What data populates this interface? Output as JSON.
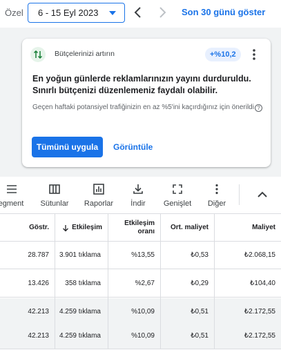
{
  "datebar": {
    "prefix": "Özel",
    "range": "6 - 15 Eyl 2023",
    "show_last_30": "Son 30 günü göster",
    "icons": {
      "prev": "chevron-left-icon",
      "next": "chevron-right-icon",
      "dropdown": "caret-down-icon"
    }
  },
  "card": {
    "icon": "sort-arrows-icon",
    "title": "Bütçelerinizi artırın",
    "badge": "+%10,2",
    "headline": "En yoğun günlerde reklamlarınızın yayını durduruldu. Sınırlı bütçenizi düzenlemeniz faydalı olabilir.",
    "body": "Geçen haftaki potansiyel trafiğinizin en az %5'ini kaçırdığınız için önerildi",
    "help_icon": "?",
    "apply_label": "Tümünü uygula",
    "view_label": "Görüntüle",
    "colors": {
      "accent": "#1a73e8",
      "badge_bg": "#e8f0fe",
      "icon_bg": "#e6f4ea"
    }
  },
  "toolbar": {
    "items": [
      {
        "label": "egment",
        "icon": "segment-icon"
      },
      {
        "label": "Sütunlar",
        "icon": "columns-icon"
      },
      {
        "label": "Raporlar",
        "icon": "reports-icon"
      },
      {
        "label": "İndir",
        "icon": "download-icon"
      },
      {
        "label": "Genişlet",
        "icon": "expand-icon"
      },
      {
        "label": "Diğer",
        "icon": "more-vert-icon"
      }
    ],
    "collapse_icon": "chevron-up-icon"
  },
  "table": {
    "headers": [
      "Göstr.",
      "Etkileşim",
      "Etkileşim oranı",
      "Ort. maliyet",
      "Maliyet"
    ],
    "sort_icon": "arrow-down-icon",
    "rows": [
      {
        "impr": "28.787",
        "interactions": "3.901 tıklama",
        "rate": "%13,55",
        "avg_cost": "₺0,53",
        "cost": "₺2.068,15"
      },
      {
        "impr": "13.426",
        "interactions": "358 tıklama",
        "rate": "%2,67",
        "avg_cost": "₺0,29",
        "cost": "₺104,40"
      },
      {
        "impr": "42.213",
        "interactions": "4.259 tıklama",
        "rate": "%10,09",
        "avg_cost": "₺0,51",
        "cost": "₺2.172,55"
      },
      {
        "impr": "42.213",
        "interactions": "4.259 tıklama",
        "rate": "%10,09",
        "avg_cost": "₺0,51",
        "cost": "₺2.172,55"
      }
    ]
  }
}
